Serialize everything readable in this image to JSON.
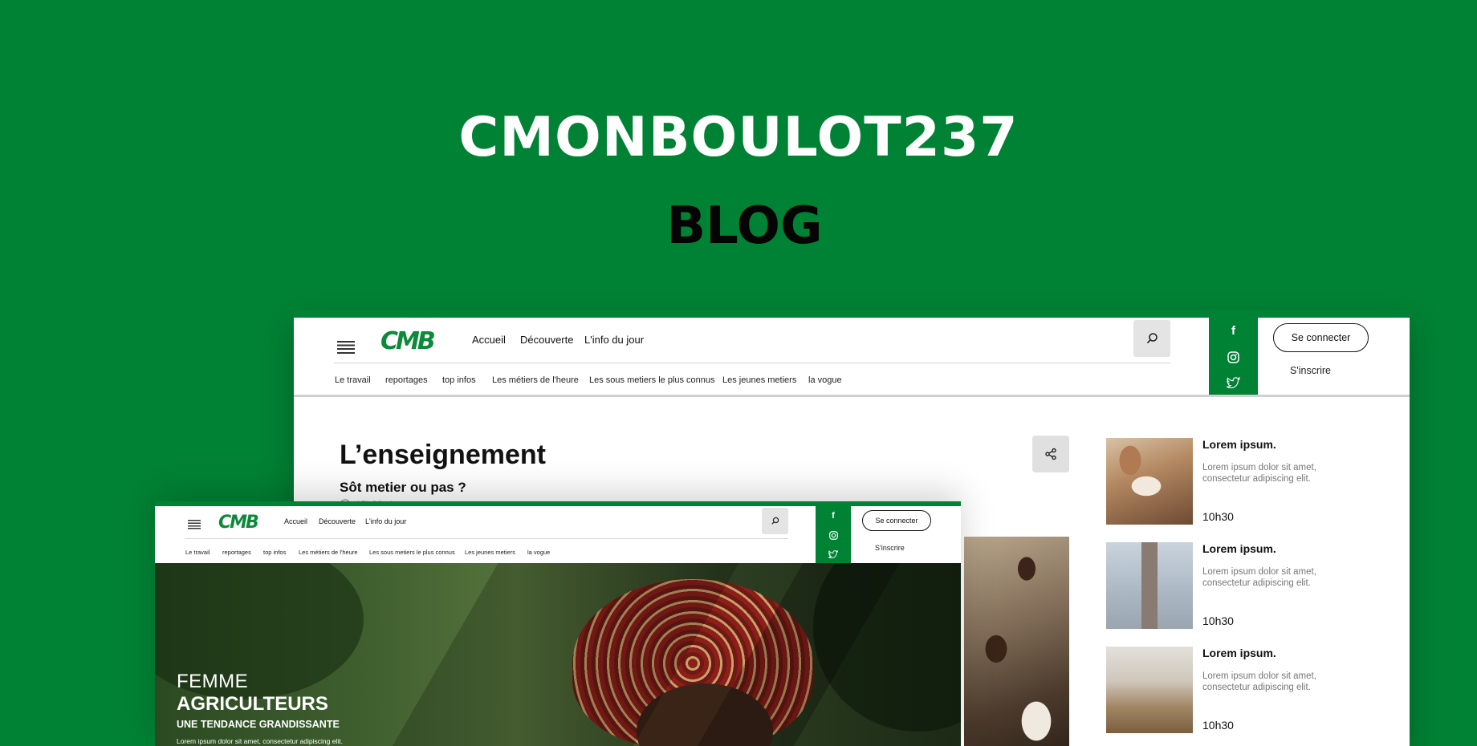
{
  "hero": {
    "title": "CMONBOULOT237",
    "subtitle": "BLOG"
  },
  "header": {
    "logo": "CMB",
    "nav": [
      "Accueil",
      "Découverte",
      "L'info du jour"
    ],
    "categories": [
      "Le travail",
      "reportages",
      "top infos",
      "Les métiers de l'heure",
      "Les sous metiers le plus connus",
      "Les jeunes metiers",
      "la vogue"
    ],
    "social_icons": [
      "facebook-icon",
      "instagram-icon",
      "twitter-icon"
    ],
    "login_label": "Se connecter",
    "signup_label": "S'inscrire"
  },
  "article": {
    "title": "L’enseignement",
    "subtitle": "Sôt metier ou pas ?",
    "time": "15h32min"
  },
  "sidebar": {
    "items": [
      {
        "title": "Lorem ipsum.",
        "desc": "Lorem ipsum dolor sit amet, consectetur adipiscing elit.",
        "time": "10h30"
      },
      {
        "title": "Lorem ipsum.",
        "desc": "Lorem ipsum dolor sit amet, consectetur adipiscing elit.",
        "time": "10h30"
      },
      {
        "title": "Lorem ipsum.",
        "desc": "Lorem ipsum dolor sit amet, consectetur adipiscing elit.",
        "time": "10h30"
      }
    ]
  },
  "feature": {
    "line1": "FEMME",
    "line2": "AGRICULTEURS",
    "line3": "UNE TENDANCE GRANDISSANTE",
    "body": "Lorem ipsum dolor sit amet, consectetur adipiscing elit."
  },
  "colors": {
    "brand": "#008234",
    "background": "#008234"
  }
}
